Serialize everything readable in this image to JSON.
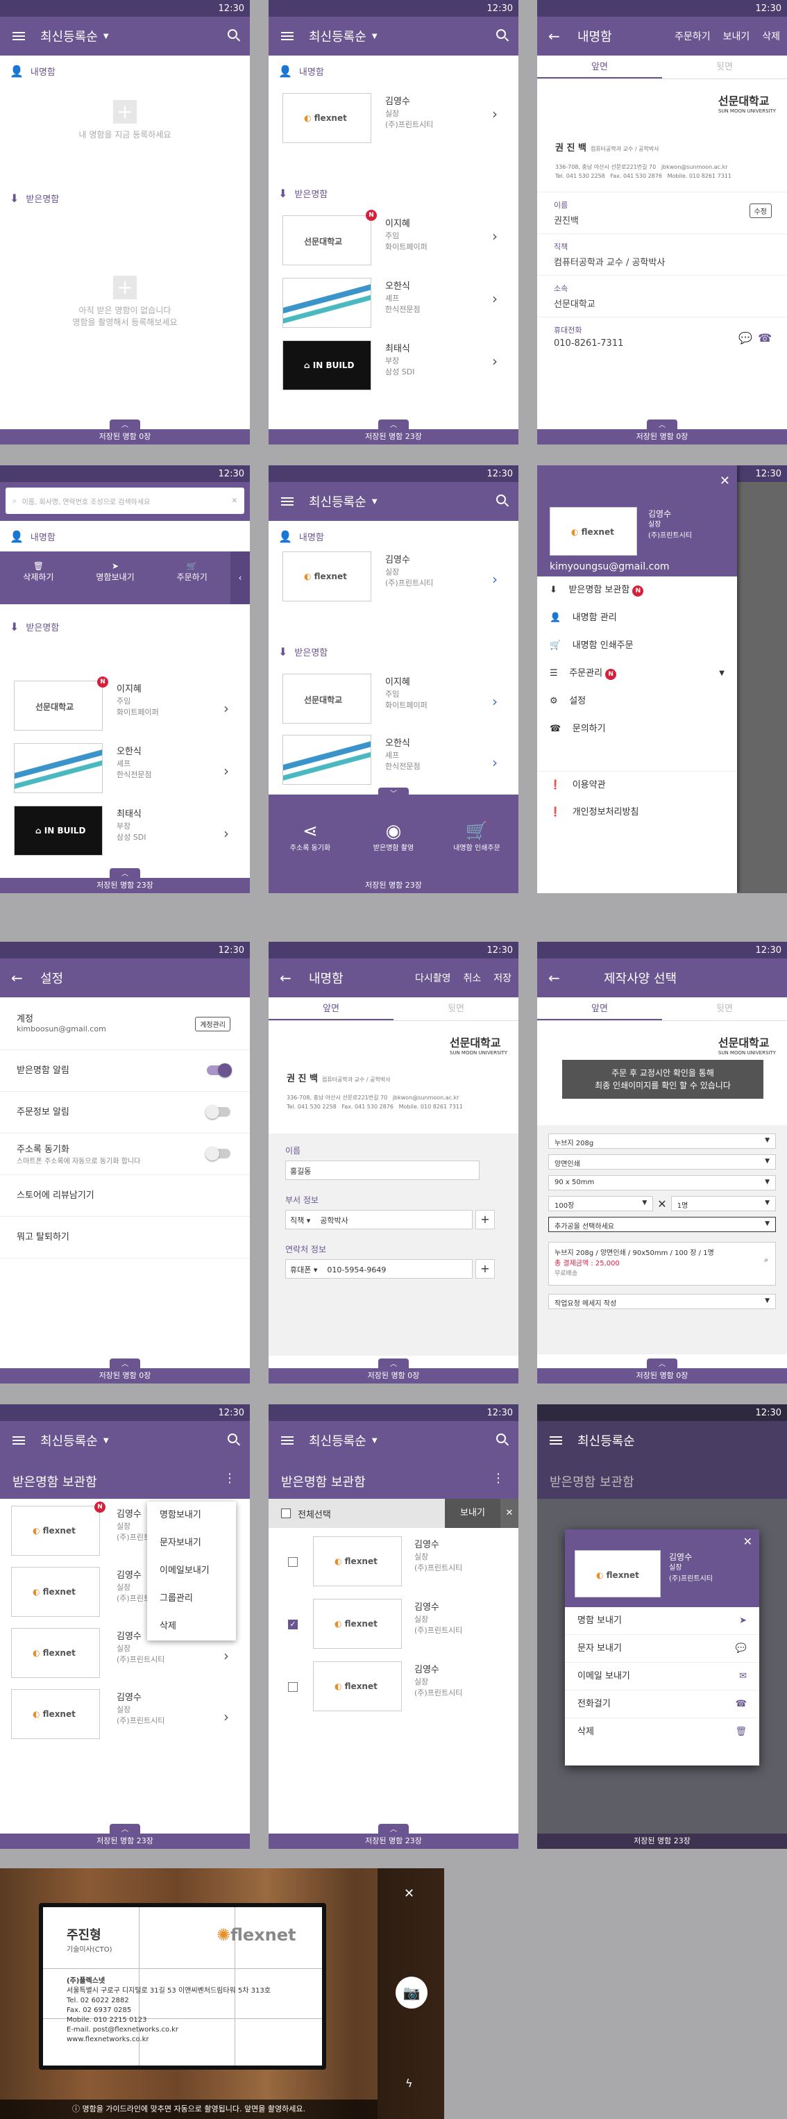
{
  "status": {
    "time": "12:30"
  },
  "sort_title": "최신등록순",
  "screen1": {
    "my_card": "내명함",
    "my_empty": "내 명함을 지금 등록하세요",
    "received": "받은명함",
    "received_empty_1": "아직 받은 명함이 없습니다",
    "received_empty_2": "명함을 촬영해서 등록해보세요",
    "footer": "저장된 명함 0장"
  },
  "mine": {
    "name": "김영수",
    "role": "실장",
    "company": "(주)프린트시티"
  },
  "contacts": [
    {
      "name": "이지혜",
      "role": "주임",
      "company": "화이트페이퍼",
      "badge": "N"
    },
    {
      "name": "오한식",
      "role": "셰프",
      "company": "한식전문점"
    },
    {
      "name": "최태식",
      "role": "부장",
      "company": "삼성 SDI"
    }
  ],
  "footer23": "저장된 명함 23장",
  "detail": {
    "title": "내명함",
    "actions": [
      "주문하기",
      "보내기",
      "삭제"
    ],
    "tabs": [
      "앞면",
      "뒷면"
    ],
    "uni": "선문대학교",
    "uni_en": "SUN MOON UNIVERSITY",
    "name": "권 진 백",
    "dept": "컴퓨터공학과 교수 / 공학박사",
    "addr": "336-708, 충남 아산시 선문로221번길 70   jbkwon@sunmoon.ac.kr\nTel. 041 530 2258   Fax. 041 530 2876   Mobile. 010 8261 7311",
    "fields": [
      {
        "label": "이름",
        "value": "권진백"
      },
      {
        "label": "직책",
        "value": "컴퓨터공학과 교수 / 공학박사"
      },
      {
        "label": "소속",
        "value": "선문대학교"
      },
      {
        "label": "휴대전화",
        "value": "010-8261-7311"
      }
    ],
    "edit": "수정"
  },
  "search": {
    "placeholder": "이름, 회사명, 연락번호 조성으로 검색하세요"
  },
  "action_bar": [
    "삭제하기",
    "명함보내기",
    "주문하기"
  ],
  "fab": [
    "주소록 동기화",
    "받은명함 촬영",
    "내명함 인쇄주문"
  ],
  "drawer": {
    "email": "kimyoungsu@gmail.com",
    "items": [
      "받은명함 보관함",
      "내명함 관리",
      "내명함 인쇄주문",
      "주문관리",
      "설정",
      "문의하기",
      "이용약관",
      "개인정보처리방침"
    ]
  },
  "settings": {
    "title": "설정",
    "account": "계정",
    "email": "kimboosun@gmail.com",
    "manage": "계정관리",
    "rows": [
      "받은명함 알림",
      "주문정보 알림",
      "주소록 동기화",
      "스토어에 리뷰남기기",
      "뭐고 탈퇴하기"
    ],
    "sync_sub": "스마트폰 주소록에 자동으로 동기화 합니다"
  },
  "edit": {
    "title": "내명함",
    "actions": [
      "다시촬영",
      "취소",
      "저장"
    ],
    "name_label": "이름",
    "name_value": "홍길동",
    "dept_label": "부서 정보",
    "dept_sel": "직책",
    "dept_value": "공학박사",
    "contact_label": "연락처 정보",
    "contact_sel": "휴대폰",
    "contact_value": "010-5954-9649"
  },
  "spec": {
    "title": "제작사양 선택",
    "toast": "주문 후 교정시안 확인을 통해\n최종 인쇄이미지를 확인 할 수 있습니다",
    "options": [
      "누브지 208g",
      "양면인쇄",
      "90 x 50mm",
      "100장",
      "1명",
      "추가공을 선택하세요"
    ],
    "summary": "누브지 208g / 양면인쇄 / 90x50mm / 100 장 / 1명",
    "total": "총 결제금액 : 25,000",
    "shipping": "무료배송",
    "memo": "작업요청 메세지 작성"
  },
  "box": {
    "title": "받은명함 보관함",
    "popup": [
      "명함보내기",
      "문자보내기",
      "이메일보내기",
      "그룹관리",
      "삭제"
    ],
    "select_all": "전체선택",
    "send": "보내기",
    "share": [
      "명함 보내기",
      "문자 보내기",
      "이메일 보내기",
      "전화걸기",
      "삭제"
    ]
  },
  "camera": {
    "name": "주진형",
    "title": "기술이사(CTO)",
    "company": "(주)플렉스넷",
    "addr": "서울특별시 구로구 디지털로 31길 53 이앤씨벤처드림타워 5차 313호",
    "tel": "Tel. 02 6022 2882",
    "fax": "Fax. 02 6937 0285",
    "mobile": "Mobile. 010 2215 0123",
    "mail": "E-mail. post@flexnetworks.co.kr",
    "web": "www.flexnetworks.co.kr",
    "hint": "명함을 가이드라인에 맞추면 자동으로 촬영됩니다. 앞면을 촬영하세요.",
    "logo": "flexnet"
  }
}
